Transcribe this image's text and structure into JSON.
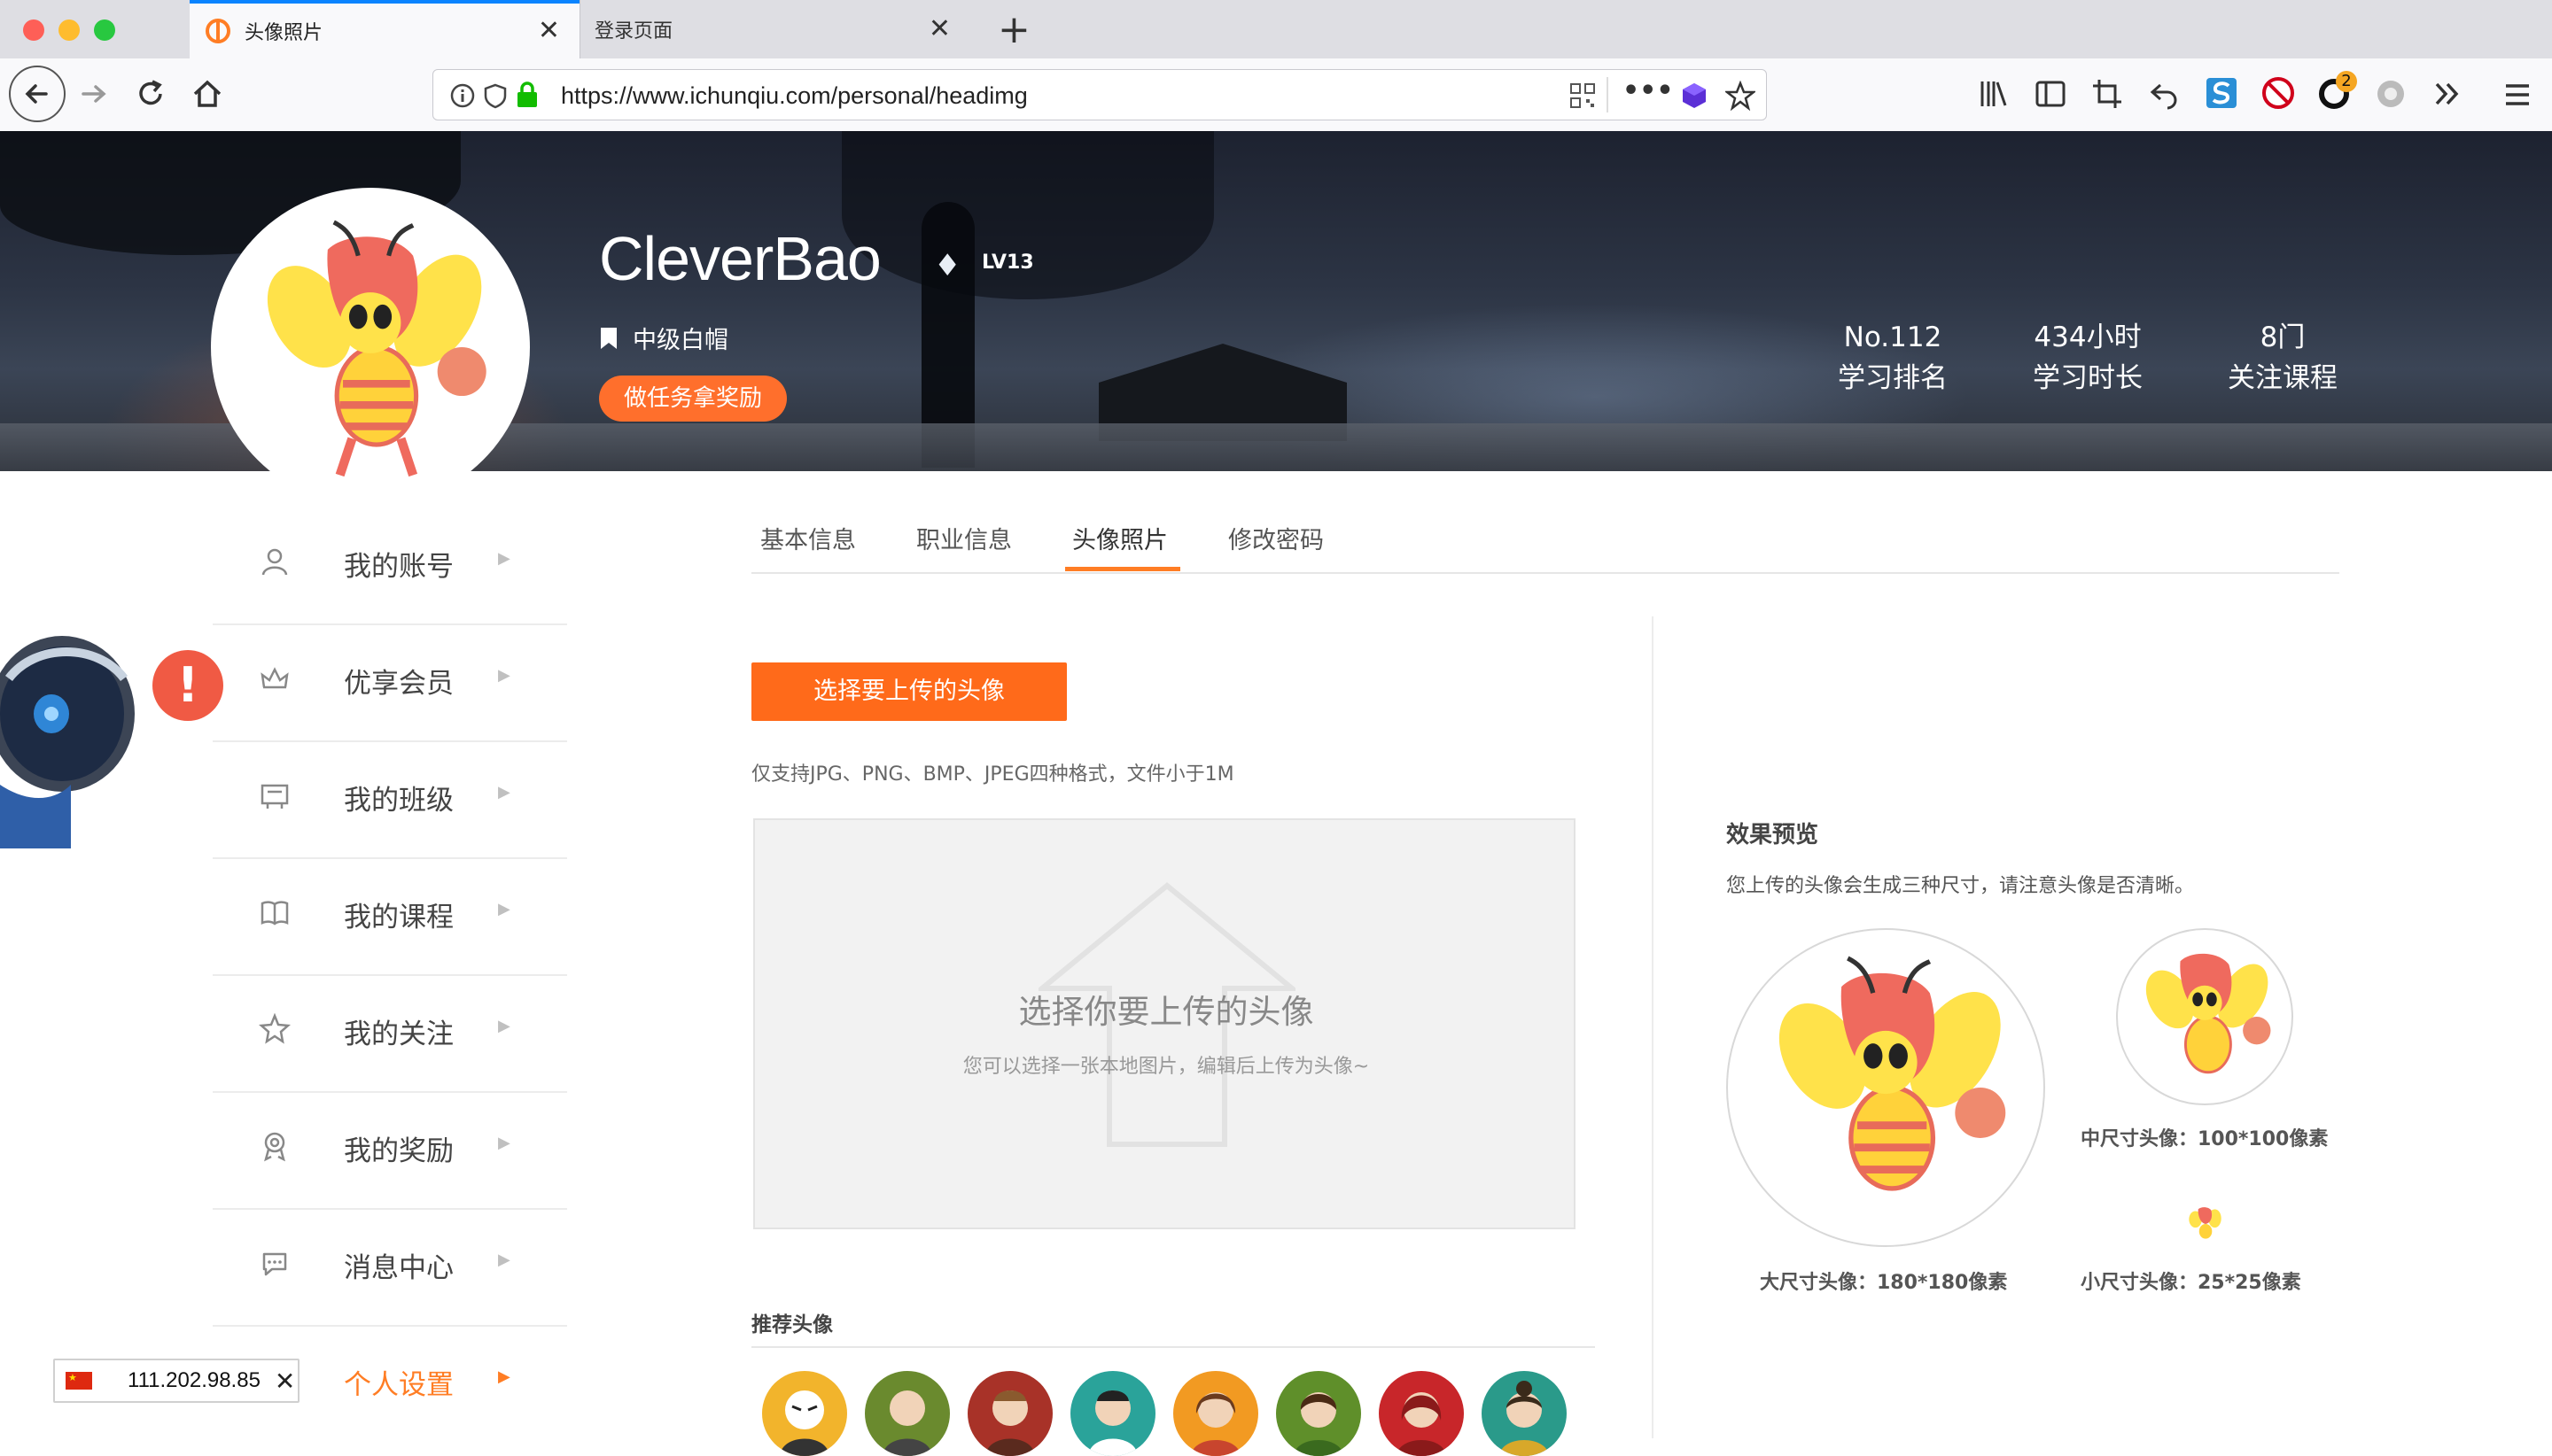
{
  "browser": {
    "tabs": [
      {
        "label": "头像照片",
        "active": true
      },
      {
        "label": "登录页面",
        "active": false
      }
    ],
    "new_tab_label": "+",
    "close_glyph": "✕",
    "url": "https://www.ichunqiu.com/personal/headimg",
    "badge_count": "2",
    "accent_color": "#0a84ff"
  },
  "profile": {
    "username": "CleverBao",
    "level": "LV13",
    "title": "中级白帽",
    "task_button": "做任务拿奖励",
    "stats": [
      {
        "value": "No.112",
        "label": "学习排名"
      },
      {
        "value": "434小时",
        "label": "学习时长"
      },
      {
        "value": "8门",
        "label": "关注课程"
      }
    ]
  },
  "sidebar": {
    "items": [
      {
        "label": "我的账号",
        "icon": "user-icon"
      },
      {
        "label": "优享会员",
        "icon": "crown-icon"
      },
      {
        "label": "我的班级",
        "icon": "board-icon"
      },
      {
        "label": "我的课程",
        "icon": "book-icon"
      },
      {
        "label": "我的关注",
        "icon": "star-icon"
      },
      {
        "label": "我的奖励",
        "icon": "medal-icon"
      },
      {
        "label": "消息中心",
        "icon": "chat-icon"
      },
      {
        "label": "个人设置",
        "icon": "settings-icon",
        "active": true
      }
    ],
    "arrow": "▶",
    "active_color": "#ff7d24"
  },
  "content": {
    "tabs": [
      "基本信息",
      "职业信息",
      "头像照片",
      "修改密码"
    ],
    "active_tab": 2,
    "upload_button": "选择要上传的头像",
    "upload_hint": "仅支持JPG、PNG、BMP、JPEG四种格式，文件小于1M",
    "dropzone_title": "选择你要上传的头像",
    "dropzone_subtitle": "您可以选择一张本地图片，编辑后上传为头像~",
    "preview": {
      "title": "效果预览",
      "description": "您上传的头像会生成三种尺寸，请注意头像是否清晰。",
      "large_label": "大尺寸头像：180*180像素",
      "medium_label": "中尺寸头像：100*100像素",
      "small_label": "小尺寸头像：25*25像素"
    },
    "recommended_title": "推荐头像",
    "brand_color": "#ff6a1a"
  },
  "ip_widget": {
    "ip": "111.202.98.85",
    "close": "✕"
  }
}
